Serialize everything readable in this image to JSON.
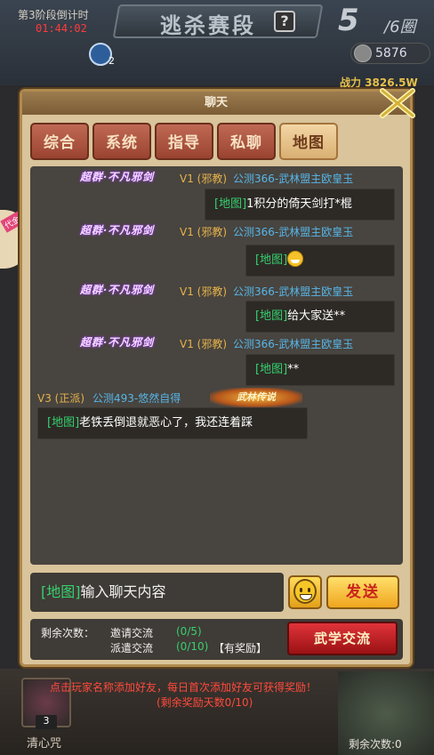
{
  "game": {
    "stage_label": "第3阶段倒计时",
    "stage_timer": "01:44:02",
    "title": "逃杀赛段",
    "help_icon": "?",
    "round_current": "5",
    "round_total": "/6圈",
    "coins": "5876",
    "mascot_count": "2",
    "power": "战力 3826.5W",
    "side_tag": "代金券"
  },
  "panel": {
    "title": "聊天",
    "tabs": [
      {
        "label": "综合",
        "active": false
      },
      {
        "label": "系统",
        "active": false
      },
      {
        "label": "指导",
        "active": false
      },
      {
        "label": "私聊",
        "active": false
      },
      {
        "label": "地图",
        "active": true
      }
    ]
  },
  "messages": [
    {
      "badge": "超群·不凡邪剑",
      "level": "V1 (邪教)",
      "name": "公测366-武林盟主欧皇玉",
      "channel": "[地图]",
      "text": "1积分的倚天剑打*棍"
    },
    {
      "badge": "超群·不凡邪剑",
      "level": "V1 (邪教)",
      "name": "公测366-武林盟主欧皇玉",
      "channel": "[地图]",
      "text": ""
    },
    {
      "badge": "超群·不凡邪剑",
      "level": "V1 (邪教)",
      "name": "公测366-武林盟主欧皇玉",
      "channel": "[地图]",
      "text": "给大家送**"
    },
    {
      "badge": "超群·不凡邪剑",
      "level": "V1 (邪教)",
      "name": "公测366-武林盟主欧皇玉",
      "channel": "[地图]",
      "text": "**"
    },
    {
      "badge": "武林传说",
      "level": "V3 (正派)",
      "name": "公测493-悠然自得",
      "channel": "[地图]",
      "text": "老铁丢倒退就恶心了，我还连着踩"
    }
  ],
  "input": {
    "channel": "[地图]",
    "placeholder": "输入聊天内容",
    "send_label": "发送"
  },
  "stats": {
    "remaining_label": "剩余次数：",
    "invite_label": "邀请交流",
    "invite_count": "(0/5)",
    "dispatch_label": "派遣交流",
    "dispatch_count": "(0/10)",
    "reward_tag": "【有奖励】",
    "exchange_label": "武学交流"
  },
  "footer": {
    "notice_line1": "点击玩家名称添加好友，每日首次添加好友可获得奖励！",
    "notice_line2": "(剩余奖励天数0/10)",
    "item_count": "3",
    "item_label": "清心咒",
    "remaining": "剩余次数:0"
  },
  "colors": {
    "channel": "#36d06e",
    "name": "#56b6e8",
    "level": "#e6b34b",
    "notice": "#ff4a3b"
  }
}
